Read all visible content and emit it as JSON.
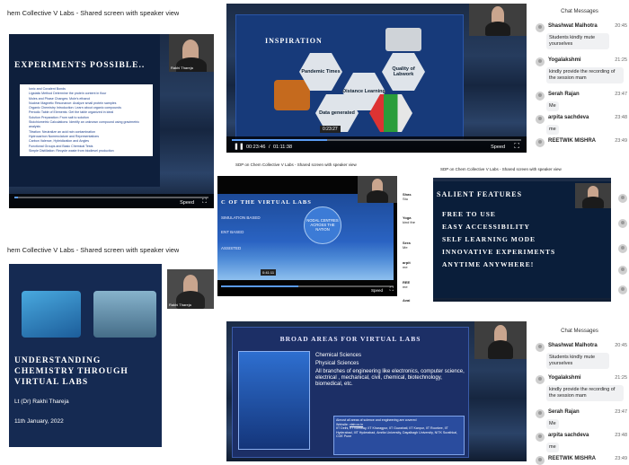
{
  "p1": {
    "header": "hem Collective V Labs - Shared screen with speaker view",
    "slide_title": "EXPERIMENTS POSSIBLE..",
    "bullets": [
      "Ionic and Covalent Bonds",
      "Ligstatic Method Determine the protein content in flour",
      "Moles and Phase Changes: Mole's ethanol",
      "Nuclear Magnetic Resonance: Analyze small protein samples",
      "Organic Chemistry Introduction: Learn about organic compounds",
      "Periodic Table of Elements: Get the table organized in ideal",
      "Solution Preparation: From salt to solution",
      "Stoichiometric Calculations: Identify an unknown compound using gravimetric analysis",
      "Titration: Neutralize an acid rain contamination",
      "Hydrocarbon Nomenclature and Representations",
      "Carbon Valence, Hybridization and Angles",
      "Functional Groups and Basic Chemical Tests",
      "Simple Distillation: Recycle waste from biodiesel production"
    ],
    "speaker_tag": "Rakhi Thareja",
    "speed_label": "Speed",
    "progress": 0.02
  },
  "p2": {
    "slide_title": "INSPIRATION",
    "hexes": {
      "pandemic": "Pandemic Times",
      "quality": "Quality of Labwork",
      "distance": "Distance Learning",
      "data": "Data generated"
    },
    "time_tooltip": "0:23:27",
    "current_time": "00:23:46",
    "total_time": "01:11:38",
    "separator": "/",
    "speed_label": "Speed",
    "progress": 0.33
  },
  "chat": {
    "title": "Chat Messages",
    "messages": [
      {
        "name": "Shashwat Malhotra",
        "time": "20:45",
        "text": "Students kindly mute yourselves"
      },
      {
        "name": "Yogalakshmi",
        "time": "21:25",
        "text": "kindly provide the recording of the session mam"
      },
      {
        "name": "Serah Rajan",
        "time": "23:47",
        "text": "Me"
      },
      {
        "name": "arpita sachdeva",
        "time": "23:48",
        "text": "me"
      },
      {
        "name": "REETWIK MISHRA",
        "time": "23:49",
        "text": "me"
      }
    ]
  },
  "p3": {
    "header": "SDP on Chem Collective V Labs - Shared screen with speaker view",
    "slide_title": "C OF THE VIRTUAL LABS",
    "lines": [
      "SIMULATION BASED",
      "ENT BASED",
      "ASSISTED"
    ],
    "circle_text": "NODAL CENTRES ACROSS THE NATION",
    "time_tooltip": "0:41:11",
    "speed_label": "Speed",
    "progress": 0.45,
    "chat_names": [
      "Shas",
      "Yoga",
      "Sera",
      "arpit",
      "REE",
      "Avai"
    ],
    "chat_texts": [
      "Stu",
      "kind the",
      "Me",
      "me",
      "me",
      ""
    ]
  },
  "p4": {
    "header": "SDP on Chem Collective V Labs - Shared screen with speaker view",
    "slide_title": "SALIENT FEATURES",
    "features": [
      "FREE TO USE",
      "EASY ACCESSIBILITY",
      "SELF LEARNING MODE",
      "INNOVATIVE EXPERIMENTS",
      "ANYTIME ANYWHERE!"
    ]
  },
  "p5": {
    "header": "hem Collective V Labs - Shared screen with speaker view",
    "title_lines": [
      "UNDERSTANDING",
      "CHEMISTRY THROUGH",
      "VIRTUAL LABS"
    ],
    "author": "Lt (Dr) Rakhi Thareja",
    "date": "11th January, 2022",
    "speaker_tag": "Rakhi Thareja"
  },
  "p6": {
    "slide_title": "BROAD AREAS FOR VIRTUAL LABS",
    "bullets": [
      "Chemical Sciences",
      "Physical Sciences",
      "All branches of engineering like electronics, computer science, electrical , mechanical, civil, chemical, biotechnology, biomedical, etc."
    ],
    "box_text": "Almost all areas of science and engineering are covered",
    "box_link_label": "Website",
    "box_link": "vlab.co.in",
    "box_lines": "IIT Delhi, IIT Bombay, IIT Kharagpur, IIT Guwahati, IIT Kanpur, IIT Roorkee, IIT Hyderabad, IIIT Hyderabad, Amrita University, Dayalbagh University, NITK Surathkal, COE Pune"
  },
  "colors": {
    "accent": "#5b9bf2",
    "navy": "#152a52",
    "slide_blue": "#173a7a"
  }
}
